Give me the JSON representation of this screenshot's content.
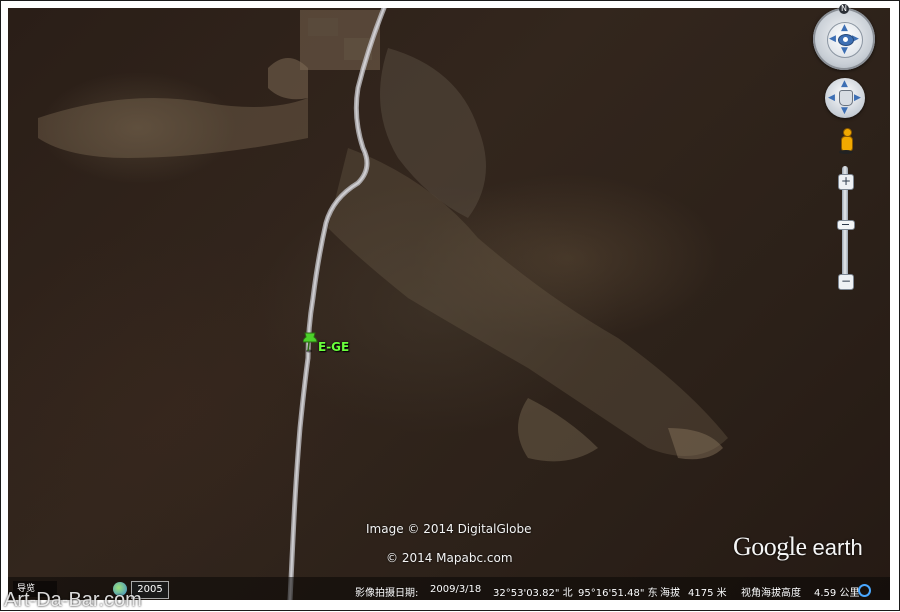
{
  "map": {
    "image_credit": "Image © 2014 DigitalGlobe",
    "map_credit": "© 2014 Mapabc.com",
    "placemark_label": "E-GE",
    "logo_google": "Google",
    "logo_earth": "earth"
  },
  "controls": {
    "north_label": "N",
    "zoom_in": "+",
    "zoom_out": "−"
  },
  "status_bar": {
    "nav_label": "导览",
    "history_year": "2005",
    "imagery_date_label": "影像拍摄日期:",
    "imagery_date": "2009/3/18",
    "latitude": "32°53'03.82\" 北",
    "longitude": "95°16'51.48\" 东",
    "elevation_label": "海拔",
    "elevation": "4175 米",
    "eye_alt_label": "视角海拔高度",
    "eye_alt": "4.59 公里"
  },
  "watermark": "Art-Da-Bar.com",
  "colors": {
    "placemark": "#6aff3c",
    "accent": "#3d6fb4",
    "status_ring": "#4aa8ff"
  }
}
